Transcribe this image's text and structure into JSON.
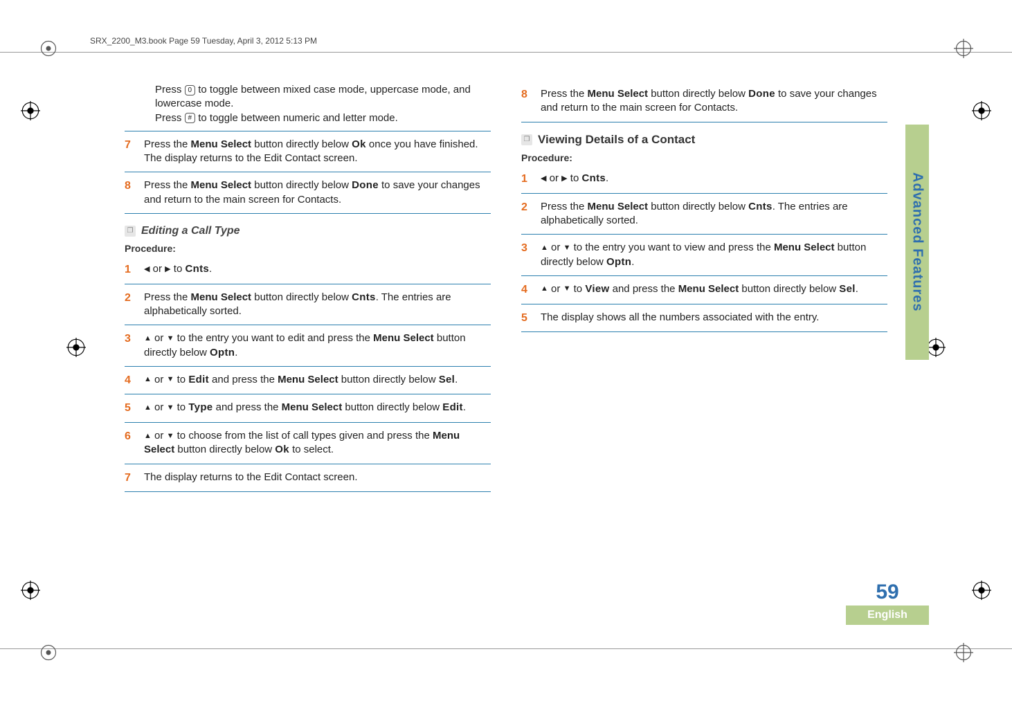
{
  "header": "SRX_2200_M3.book  Page 59  Tuesday, April 3, 2012  5:13 PM",
  "sideTab": "Advanced Features",
  "pageNumber": "59",
  "language": "English",
  "left": {
    "pre": {
      "line1a": "Press ",
      "key1": "0",
      "line1b": " to toggle between mixed case mode, uppercase mode, and lowercase mode.",
      "line2a": "Press ",
      "key2": "#",
      "line2b": " to toggle between numeric and letter mode."
    },
    "step7": {
      "num": "7",
      "a": "Press the ",
      "menuSelect": "Menu Select",
      "b": " button directly below ",
      "ok": "Ok",
      "c": " once you have finished. The display returns to the Edit Contact screen."
    },
    "step8": {
      "num": "8",
      "a": "Press the ",
      "menuSelect": "Menu Select",
      "b": " button directly below ",
      "done": "Done",
      "c": " to save your changes and return to the main screen for Contacts."
    },
    "sectionA": {
      "title": "Editing a Call Type",
      "procLabel": "Procedure:",
      "s1": {
        "num": "1",
        "a": " or ",
        "b": " to ",
        "cnts": "Cnts",
        "c": "."
      },
      "s2": {
        "num": "2",
        "a": "Press the ",
        "menuSelect": "Menu Select",
        "b": " button directly below ",
        "cnts": "Cnts",
        "c": ". The entries are alphabetically sorted."
      },
      "s3": {
        "num": "3",
        "a": " or ",
        "b": " to the entry you want to edit and press the ",
        "menuSelect": "Menu Select",
        "c": " button directly below ",
        "optn": "Optn",
        "d": "."
      },
      "s4": {
        "num": "4",
        "a": " or ",
        "b": " to ",
        "edit": "Edit",
        "c": " and press the ",
        "menuSelect": "Menu Select",
        "d": " button directly below ",
        "sel": "Sel",
        "e": "."
      },
      "s5": {
        "num": "5",
        "a": " or ",
        "b": " to ",
        "type": "Type",
        "c": " and press the ",
        "menuSelect": "Menu Select",
        "d": " button directly below ",
        "edit": "Edit",
        "e": "."
      },
      "s6": {
        "num": "6",
        "a": " or ",
        "b": " to choose from the list of call types given and press the ",
        "menuSelect": "Menu Select",
        "c": " button directly below ",
        "ok": "Ok",
        "d": " to select."
      },
      "s7": {
        "num": "7",
        "a": "The display returns to the Edit Contact screen."
      }
    }
  },
  "right": {
    "step8": {
      "num": "8",
      "a": "Press the ",
      "menuSelect": "Menu Select",
      "b": " button directly below ",
      "done": "Done",
      "c": " to save your changes and return to the main screen for Contacts."
    },
    "sectionB": {
      "title": "Viewing Details of a Contact",
      "procLabel": "Procedure:",
      "s1": {
        "num": "1",
        "a": " or ",
        "b": " to ",
        "cnts": "Cnts",
        "c": "."
      },
      "s2": {
        "num": "2",
        "a": "Press the ",
        "menuSelect": "Menu Select",
        "b": " button directly below ",
        "cnts": "Cnts",
        "c": ". The entries are alphabetically sorted."
      },
      "s3": {
        "num": "3",
        "a": " or ",
        "b": " to the entry you want to view and press the ",
        "menuSelect": "Menu Select",
        "c": " button directly below ",
        "optn": "Optn",
        "d": "."
      },
      "s4": {
        "num": "4",
        "a": " or ",
        "b": " to ",
        "view": "View",
        "c": " and press the ",
        "menuSelect": "Menu Select",
        "d": " button directly below ",
        "sel": "Sel",
        "e": "."
      },
      "s5": {
        "num": "5",
        "a": "The display shows all the numbers associated with the entry."
      }
    }
  }
}
